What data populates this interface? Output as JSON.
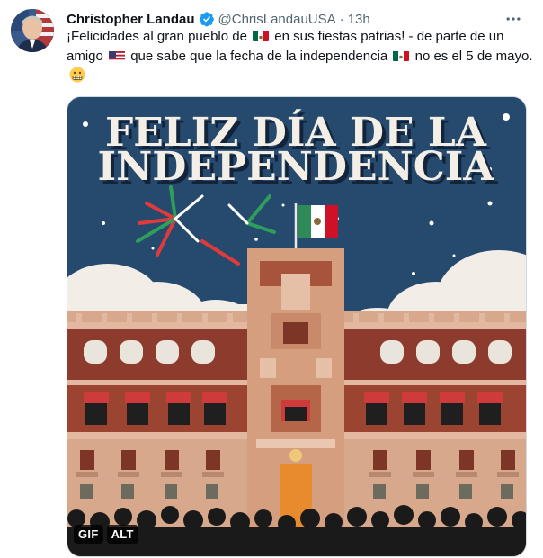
{
  "tweet": {
    "author_name": "Christopher Landau",
    "handle": "@ChrisLandauUSA",
    "separator": "·",
    "time": "13h",
    "text_seg1": "¡Felicidades al gran pueblo de ",
    "text_seg2": " en sus fiestas patrias! - de parte de un amigo ",
    "text_seg3": " que sabe que la fecha de la independencia ",
    "text_seg4": " no es el 5 de mayo.",
    "emoji": [
      "mexico-flag",
      "us-flag",
      "mexico-flag",
      "grimacing-face"
    ]
  },
  "media": {
    "title_line1": "FELIZ DÍA DE LA",
    "title_line2": "INDEPENDENCIA",
    "gif_badge": "GIF",
    "alt_badge": "ALT"
  },
  "icons": {
    "verified": "verified-badge-icon",
    "more": "more-horizontal-icon"
  },
  "colors": {
    "verified_blue": "#1d9bf0",
    "text_primary": "#0f1419",
    "text_secondary": "#536471",
    "sky": "#264a6e",
    "palace_red": "#8c3b2c",
    "palace_sand": "#d9a98a",
    "door_orange": "#e88a2e"
  }
}
